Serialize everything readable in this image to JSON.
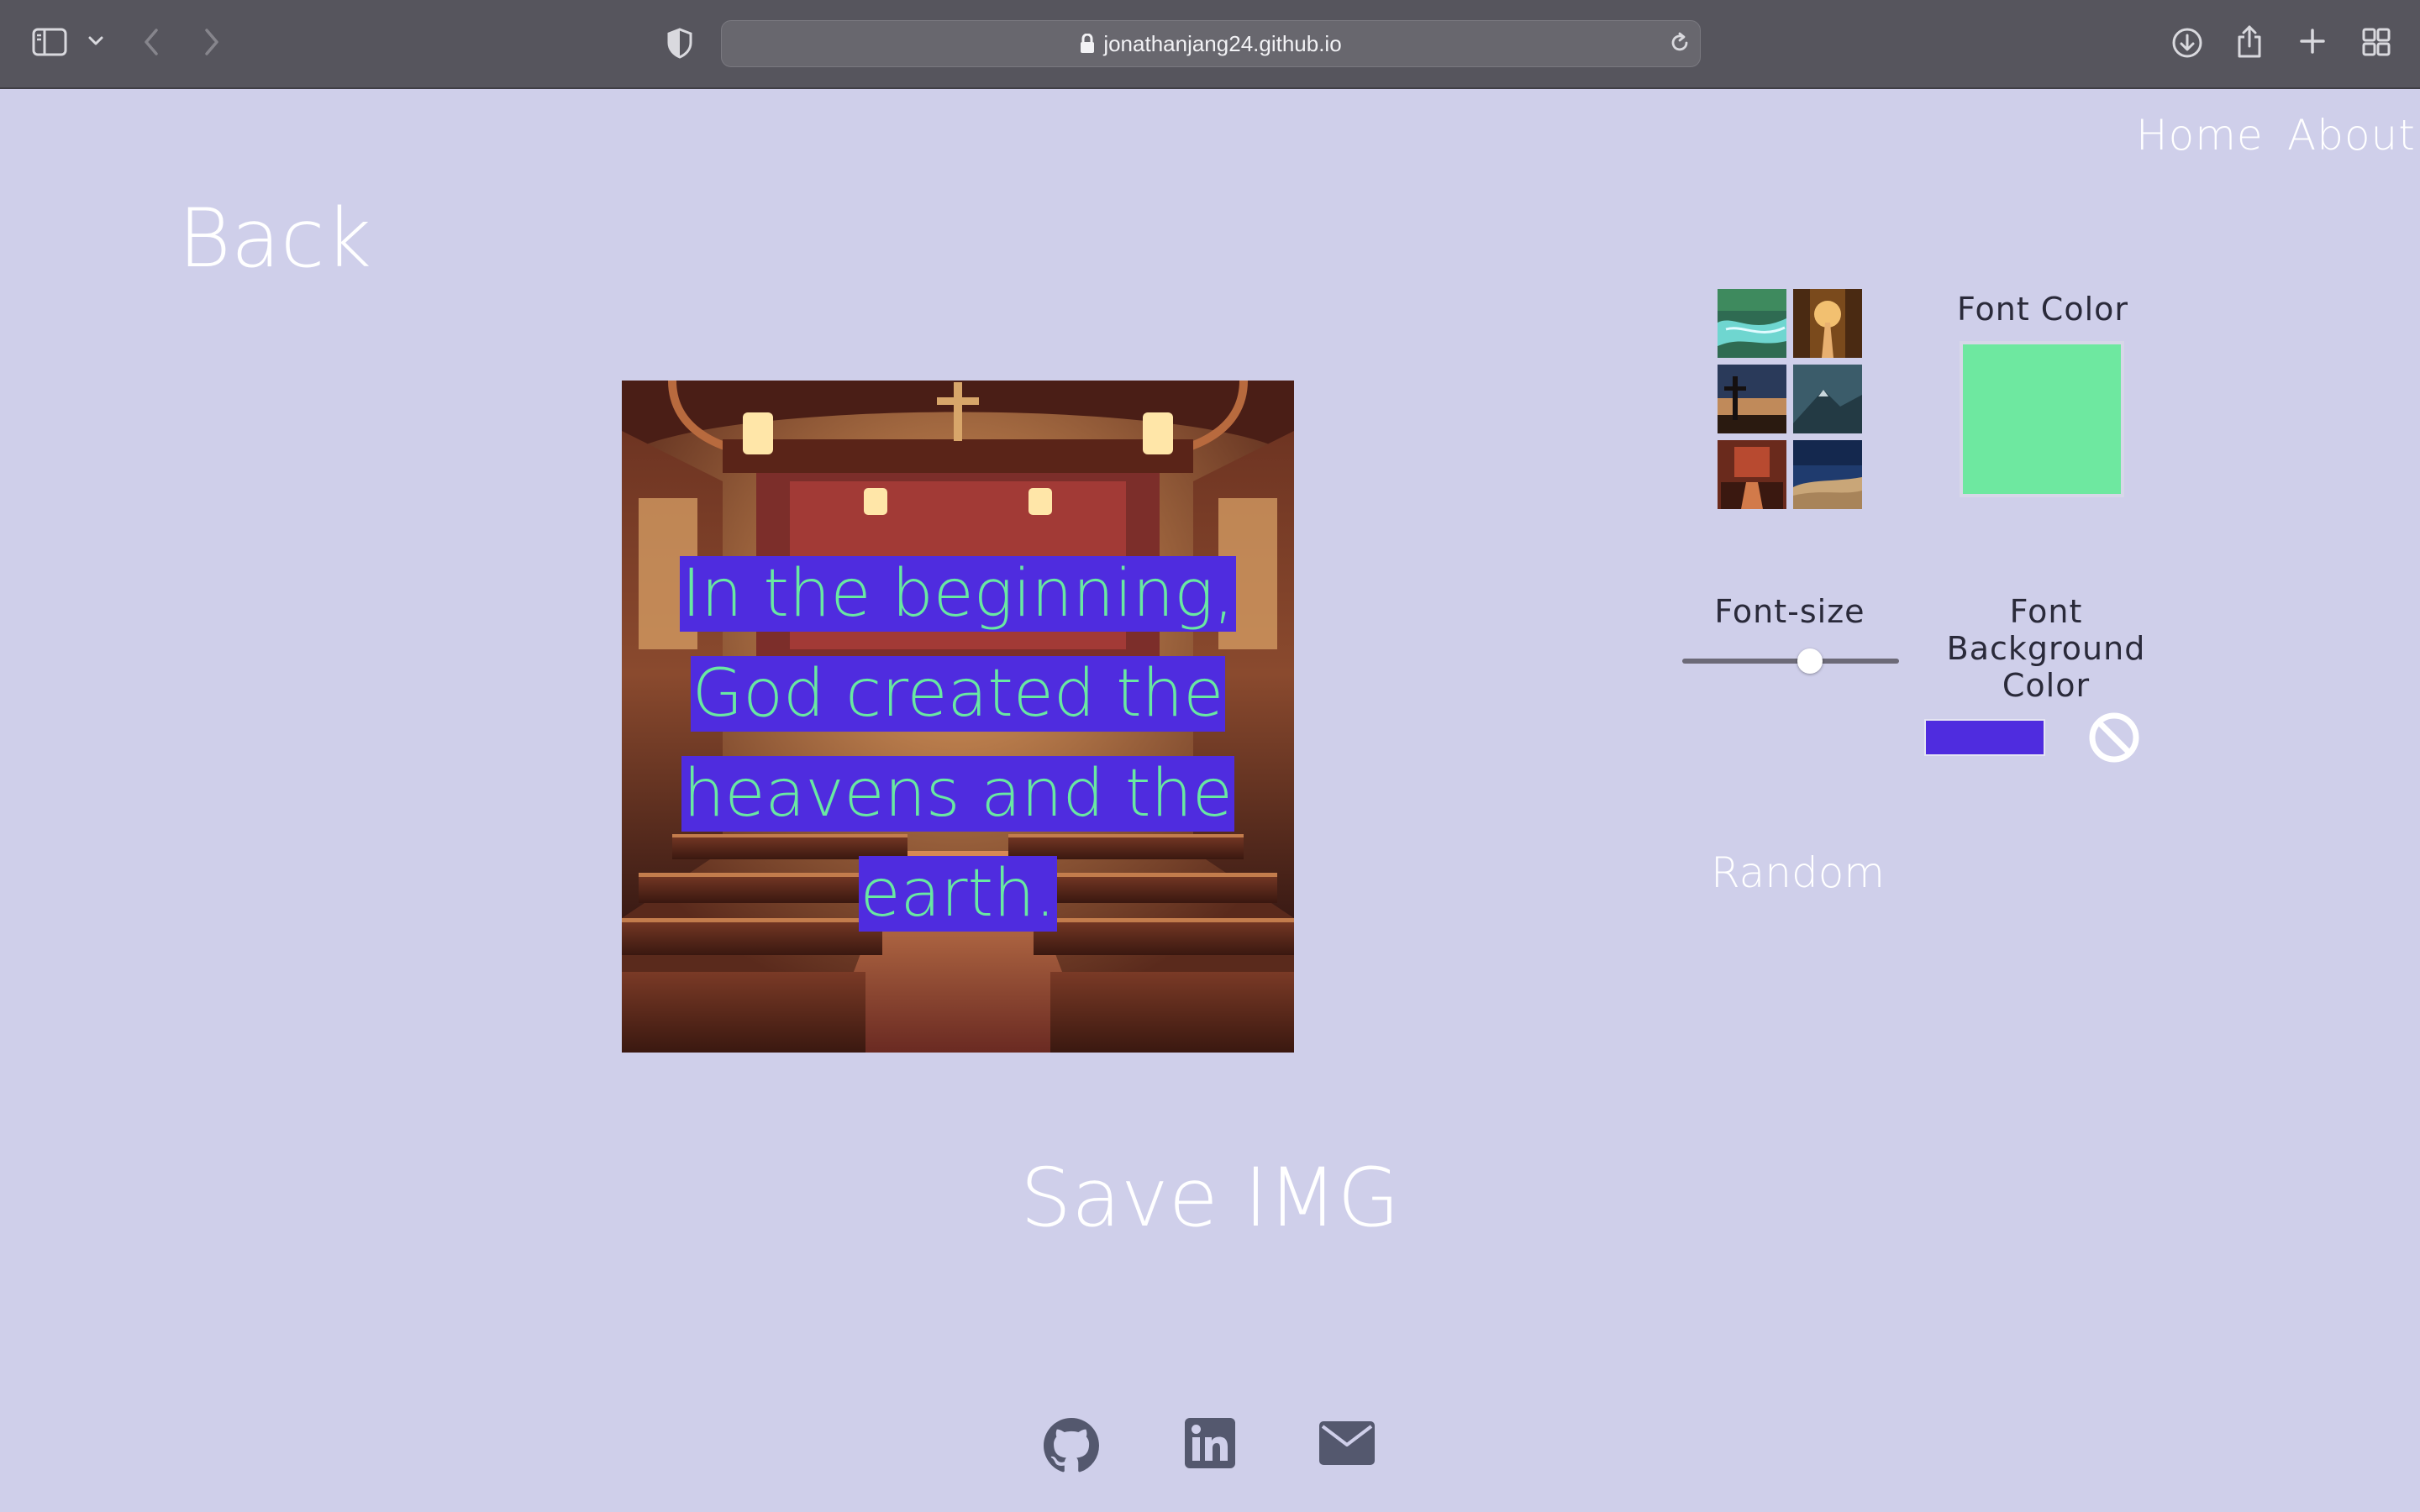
{
  "browser": {
    "url": "jonathanjang24.github.io"
  },
  "nav": {
    "home": "Home",
    "about": "About"
  },
  "back_label": "Back",
  "verse": {
    "text": "In the beginning, God created the heavens and the earth.",
    "font_color": "#69e8a2",
    "background_color": "#4f2cdf"
  },
  "save_label": "Save IMG",
  "controls": {
    "font_color_label": "Font Color",
    "font_color_value": "#6ee8a0",
    "font_size_label": "Font-size",
    "font_size_level": 0.6,
    "font_bg_label_lines": [
      "Font",
      "Background",
      "Color"
    ],
    "font_bg_value": "#4f2cdf",
    "random_label": "Random",
    "backgrounds": [
      "river-icon",
      "forest-path-icon",
      "cross-sunset-icon",
      "mountain-icon",
      "church-interior-icon",
      "desert-night-icon"
    ]
  },
  "footer": {
    "icons": [
      "github-icon",
      "linkedin-icon",
      "email-icon"
    ]
  },
  "colors": {
    "page_bg": "#cfcfea",
    "chrome_bg": "#56555d",
    "social_icon": "#54586e"
  }
}
